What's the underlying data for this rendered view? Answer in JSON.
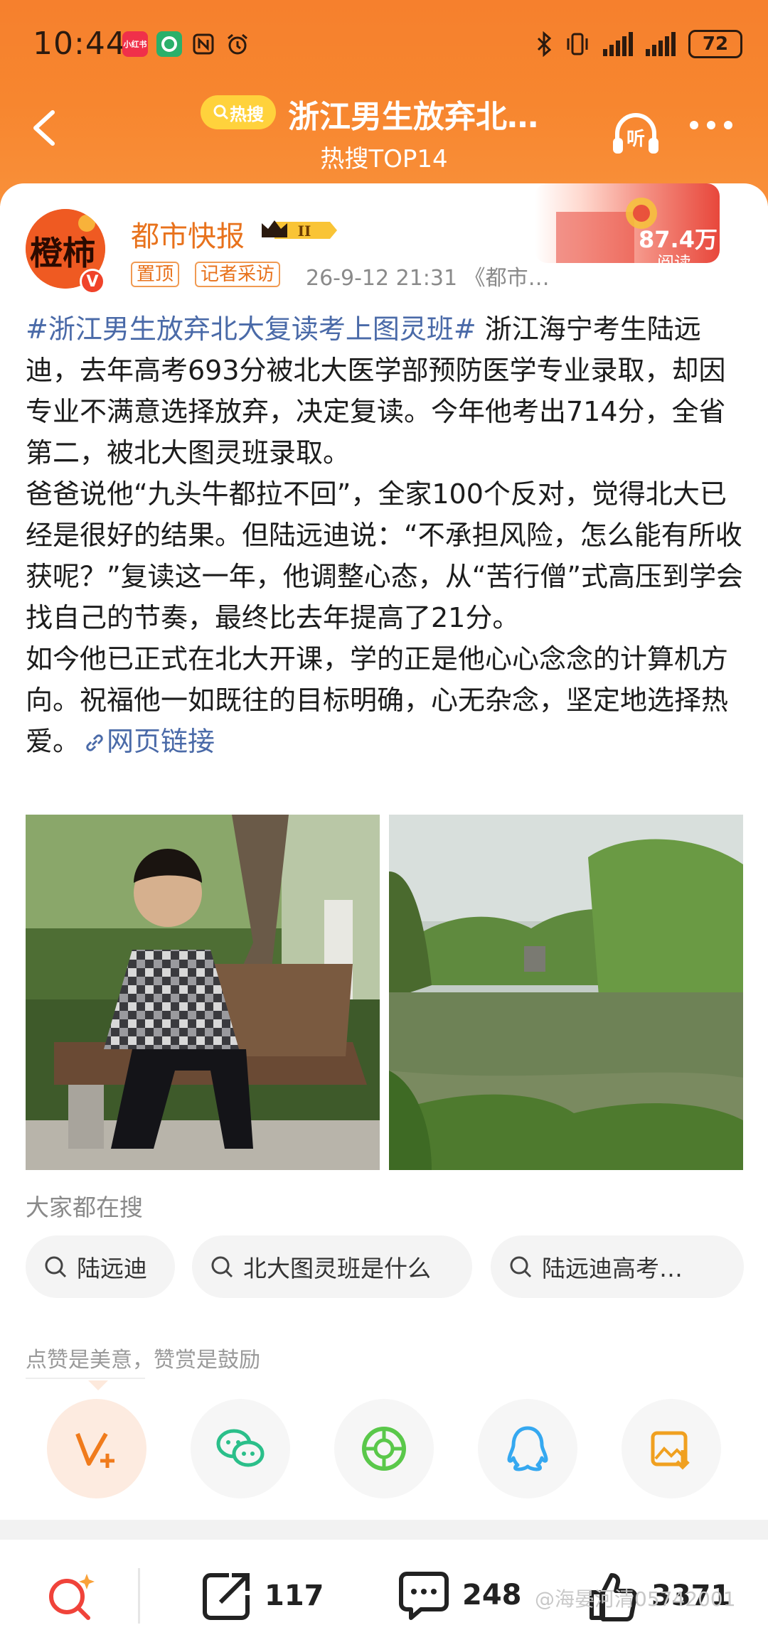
{
  "status_bar": {
    "time": "10:44",
    "app_icon_label": "小红书",
    "battery": "72"
  },
  "nav": {
    "hot_badge": "热搜",
    "title": "浙江男生放弃北…",
    "subtitle": "热搜TOP14",
    "listen_label": "听"
  },
  "post": {
    "avatar_text": "橙柿",
    "verified_badge": "V",
    "author": "都市快报",
    "level": "II",
    "tag_pinned": "置顶",
    "tag_reporter": "记者采访",
    "meta": "26-9-12 21:31 《都市…",
    "reads_count": "87.4万",
    "reads_label": "阅读",
    "hashtag": "#浙江男生放弃北大复读考上图灵班#",
    "p1": " 浙江海宁考生陆远迪，去年高考693分被北大医学部预防医学专业录取，却因专业不满意选择放弃，决定复读。今年他考出714分，全省第二，被北大图灵班录取。",
    "p2": "爸爸说他“九头牛都拉不回”，全家100个反对，觉得北大已经是很好的结果。但陆远迪说：“不承担风险，怎么能有所收获呢？”复读这一年，他调整心态，从“苦行僧”式高压到学会找自己的节奏，最终比去年提高了21分。",
    "p3": "如今他已正式在北大开课，学的正是他心心念念的计算机方向。祝福他一如既往的目标明确，心无杂念，坚定地选择热爱。",
    "link_label": "网页链接"
  },
  "search": {
    "heading": "大家都在搜",
    "chips": [
      "陆远迪",
      "北大图灵班是什么",
      "陆远迪高考…"
    ]
  },
  "praise_text": "点赞是美意，赞赏是鼓励",
  "actions": {
    "repost_count": "117",
    "comment_count": "248",
    "like_count": "3371"
  },
  "watermark": "@海晏河清05742001",
  "colors": {
    "header": "#f7862f",
    "accent": "#e8721c",
    "link": "#4a6aa8"
  }
}
